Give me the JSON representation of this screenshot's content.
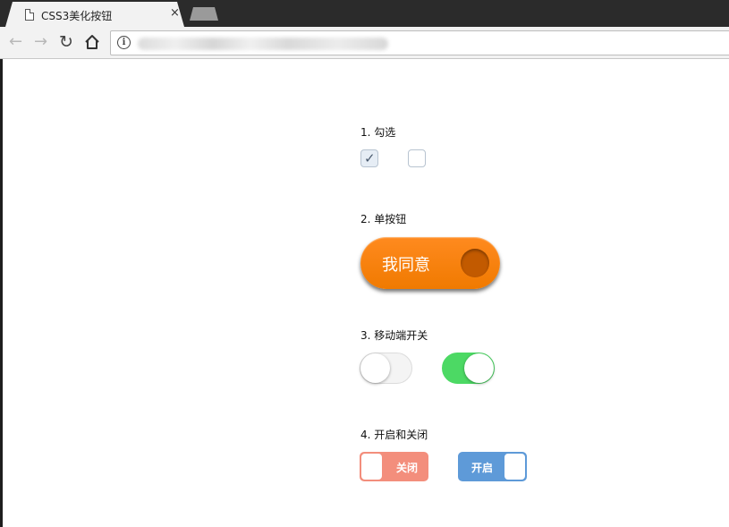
{
  "browser": {
    "tab_title": "CSS3美化按钮",
    "tab_close": "×",
    "icons": {
      "back": "back-arrow-icon",
      "forward": "forward-arrow-icon",
      "reload": "reload-icon",
      "home": "home-icon",
      "info": "info-icon",
      "page": "page-document-icon"
    },
    "info_glyph": "i"
  },
  "sections": {
    "checkbox": {
      "title": "1. 勾选",
      "checked": true,
      "unchecked": false,
      "tick": "✓"
    },
    "single_button": {
      "title": "2. 单按钮",
      "label": "我同意",
      "color": "#f57e0a"
    },
    "mobile_switch": {
      "title": "3. 移动端开关",
      "off_state": false,
      "on_state": true,
      "on_color": "#4cd964"
    },
    "open_close": {
      "title": "4. 开启和关闭",
      "close_label": "关闭",
      "open_label": "开启",
      "close_color": "#f38e7c",
      "open_color": "#5e9ad8"
    }
  }
}
